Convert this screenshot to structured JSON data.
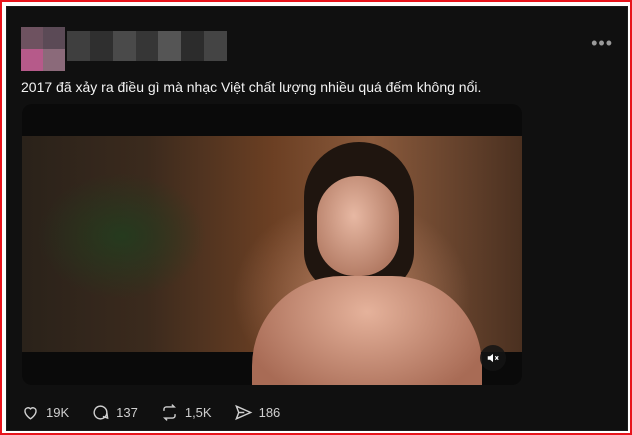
{
  "post": {
    "text": "2017 đã xảy ra điều gì mà nhạc Việt chất lượng nhiều quá đếm không nổi.",
    "more_icon": "•••"
  },
  "media": {
    "mute_icon": "speaker-muted-icon"
  },
  "actions": {
    "likes": "19K",
    "comments": "137",
    "reposts": "1,5K",
    "shares": "186"
  },
  "colors": {
    "frame_border": "#e8141c",
    "card_bg": "#101010",
    "text": "#f3f3f3",
    "muted_text": "#cfcfcf"
  }
}
